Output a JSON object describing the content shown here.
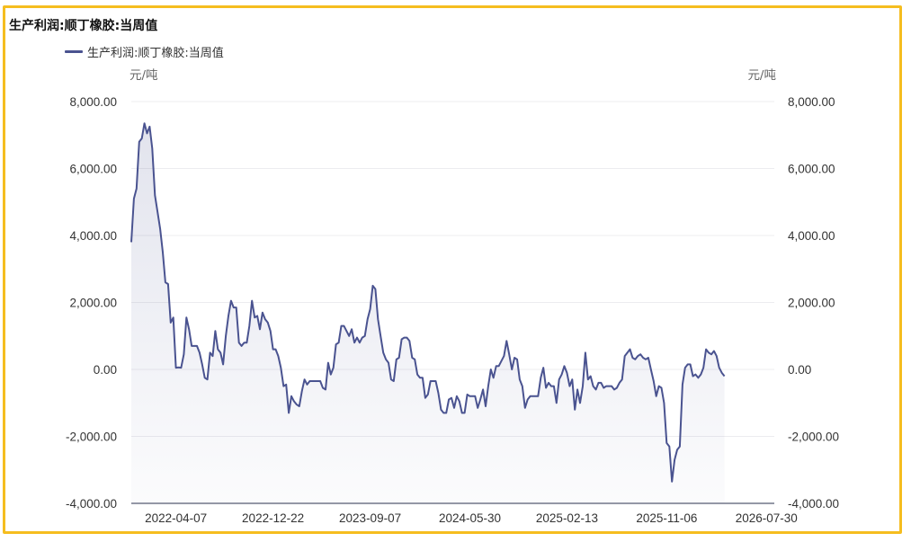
{
  "chart_data": {
    "type": "area",
    "title": "生产利润:顺丁橡胶:当周值",
    "legend": "生产利润:顺丁橡胶:当周值",
    "y_unit_left": "元/吨",
    "y_unit_right": "元/吨",
    "ylim": [
      -4000,
      8000
    ],
    "yticks": [
      "8,000.00",
      "6,000.00",
      "4,000.00",
      "2,000.00",
      "0.00",
      "-2,000.00",
      "-4,000.00"
    ],
    "xticks": [
      "2022-04-07",
      "2022-12-22",
      "2023-09-07",
      "2024-05-30",
      "2025-02-13",
      "2025-11-06",
      "2026-07-30"
    ],
    "xlim": [
      "2021-12-09",
      "2026-08-20"
    ],
    "grid": true,
    "line_color": "#4a5390",
    "series": [
      {
        "name": "生产利润:顺丁橡胶:当周值",
        "points": [
          [
            "2021-12-09",
            3800
          ],
          [
            "2021-12-16",
            5100
          ],
          [
            "2021-12-23",
            5400
          ],
          [
            "2021-12-30",
            6800
          ],
          [
            "2022-01-06",
            6900
          ],
          [
            "2022-01-13",
            7350
          ],
          [
            "2022-01-20",
            7050
          ],
          [
            "2022-01-27",
            7250
          ],
          [
            "2022-02-03",
            6600
          ],
          [
            "2022-02-10",
            5200
          ],
          [
            "2022-02-17",
            4700
          ],
          [
            "2022-02-24",
            4200
          ],
          [
            "2022-03-03",
            3500
          ],
          [
            "2022-03-10",
            2600
          ],
          [
            "2022-03-17",
            2550
          ],
          [
            "2022-03-24",
            1400
          ],
          [
            "2022-03-31",
            1550
          ],
          [
            "2022-04-07",
            50
          ],
          [
            "2022-04-14",
            60
          ],
          [
            "2022-04-21",
            50
          ],
          [
            "2022-04-28",
            450
          ],
          [
            "2022-05-05",
            1550
          ],
          [
            "2022-05-12",
            1200
          ],
          [
            "2022-05-19",
            700
          ],
          [
            "2022-05-26",
            700
          ],
          [
            "2022-06-02",
            700
          ],
          [
            "2022-06-09",
            500
          ],
          [
            "2022-06-16",
            150
          ],
          [
            "2022-06-23",
            -250
          ],
          [
            "2022-06-30",
            -300
          ],
          [
            "2022-07-07",
            500
          ],
          [
            "2022-07-14",
            400
          ],
          [
            "2022-07-21",
            1150
          ],
          [
            "2022-07-28",
            600
          ],
          [
            "2022-08-04",
            500
          ],
          [
            "2022-08-11",
            150
          ],
          [
            "2022-08-18",
            1000
          ],
          [
            "2022-08-25",
            1600
          ],
          [
            "2022-09-01",
            2050
          ],
          [
            "2022-09-08",
            1850
          ],
          [
            "2022-09-15",
            1850
          ],
          [
            "2022-09-22",
            800
          ],
          [
            "2022-09-29",
            700
          ],
          [
            "2022-10-06",
            800
          ],
          [
            "2022-10-13",
            800
          ],
          [
            "2022-10-20",
            1300
          ],
          [
            "2022-10-27",
            2050
          ],
          [
            "2022-11-03",
            1550
          ],
          [
            "2022-11-10",
            1600
          ],
          [
            "2022-11-17",
            1200
          ],
          [
            "2022-11-24",
            1700
          ],
          [
            "2022-12-01",
            1500
          ],
          [
            "2022-12-08",
            1400
          ],
          [
            "2022-12-15",
            1150
          ],
          [
            "2022-12-22",
            600
          ],
          [
            "2022-12-29",
            600
          ],
          [
            "2023-01-05",
            400
          ],
          [
            "2023-01-12",
            50
          ],
          [
            "2023-01-19",
            -500
          ],
          [
            "2023-01-26",
            -450
          ],
          [
            "2023-02-02",
            -1300
          ],
          [
            "2023-02-09",
            -800
          ],
          [
            "2023-02-16",
            -950
          ],
          [
            "2023-02-23",
            -1050
          ],
          [
            "2023-03-02",
            -1100
          ],
          [
            "2023-03-09",
            -650
          ],
          [
            "2023-03-16",
            -300
          ],
          [
            "2023-03-23",
            -450
          ],
          [
            "2023-03-30",
            -350
          ],
          [
            "2023-04-06",
            -350
          ],
          [
            "2023-04-13",
            -350
          ],
          [
            "2023-04-20",
            -350
          ],
          [
            "2023-04-27",
            -350
          ],
          [
            "2023-05-04",
            -550
          ],
          [
            "2023-05-11",
            -600
          ],
          [
            "2023-05-18",
            200
          ],
          [
            "2023-05-25",
            -150
          ],
          [
            "2023-06-01",
            50
          ],
          [
            "2023-06-08",
            750
          ],
          [
            "2023-06-15",
            800
          ],
          [
            "2023-06-22",
            1300
          ],
          [
            "2023-06-29",
            1300
          ],
          [
            "2023-07-06",
            1150
          ],
          [
            "2023-07-13",
            1000
          ],
          [
            "2023-07-20",
            1200
          ],
          [
            "2023-07-27",
            800
          ],
          [
            "2023-08-03",
            950
          ],
          [
            "2023-08-10",
            800
          ],
          [
            "2023-08-17",
            950
          ],
          [
            "2023-08-24",
            1000
          ],
          [
            "2023-08-31",
            1500
          ],
          [
            "2023-09-07",
            1800
          ],
          [
            "2023-09-14",
            2500
          ],
          [
            "2023-09-21",
            2400
          ],
          [
            "2023-09-28",
            1500
          ],
          [
            "2023-10-05",
            1000
          ],
          [
            "2023-10-12",
            500
          ],
          [
            "2023-10-19",
            300
          ],
          [
            "2023-10-26",
            200
          ],
          [
            "2023-11-02",
            -300
          ],
          [
            "2023-11-09",
            -350
          ],
          [
            "2023-11-16",
            300
          ],
          [
            "2023-11-23",
            350
          ],
          [
            "2023-11-30",
            900
          ],
          [
            "2023-12-07",
            950
          ],
          [
            "2023-12-14",
            950
          ],
          [
            "2023-12-21",
            850
          ],
          [
            "2023-12-28",
            350
          ],
          [
            "2024-01-04",
            300
          ],
          [
            "2024-01-11",
            -150
          ],
          [
            "2024-01-18",
            -250
          ],
          [
            "2024-01-25",
            -250
          ],
          [
            "2024-02-01",
            -850
          ],
          [
            "2024-02-08",
            -750
          ],
          [
            "2024-02-15",
            -350
          ],
          [
            "2024-02-22",
            -350
          ],
          [
            "2024-02-29",
            -350
          ],
          [
            "2024-03-07",
            -700
          ],
          [
            "2024-03-14",
            -1200
          ],
          [
            "2024-03-21",
            -1300
          ],
          [
            "2024-03-28",
            -1300
          ],
          [
            "2024-04-04",
            -900
          ],
          [
            "2024-04-11",
            -850
          ],
          [
            "2024-04-18",
            -1150
          ],
          [
            "2024-04-25",
            -800
          ],
          [
            "2024-05-02",
            -950
          ],
          [
            "2024-05-09",
            -1300
          ],
          [
            "2024-05-16",
            -1300
          ],
          [
            "2024-05-23",
            -750
          ],
          [
            "2024-05-30",
            -800
          ],
          [
            "2024-06-06",
            -800
          ],
          [
            "2024-06-13",
            -800
          ],
          [
            "2024-06-20",
            -1150
          ],
          [
            "2024-06-27",
            -900
          ],
          [
            "2024-07-04",
            -600
          ],
          [
            "2024-07-11",
            -1100
          ],
          [
            "2024-07-18",
            -500
          ],
          [
            "2024-07-25",
            0
          ],
          [
            "2024-08-01",
            -250
          ],
          [
            "2024-08-08",
            100
          ],
          [
            "2024-08-15",
            100
          ],
          [
            "2024-08-22",
            250
          ],
          [
            "2024-08-29",
            400
          ],
          [
            "2024-09-05",
            850
          ],
          [
            "2024-09-12",
            450
          ],
          [
            "2024-09-19",
            0
          ],
          [
            "2024-09-26",
            350
          ],
          [
            "2024-10-03",
            300
          ],
          [
            "2024-10-10",
            -300
          ],
          [
            "2024-10-17",
            -500
          ],
          [
            "2024-10-24",
            -1150
          ],
          [
            "2024-10-31",
            -900
          ],
          [
            "2024-11-07",
            -800
          ],
          [
            "2024-11-14",
            -800
          ],
          [
            "2024-11-21",
            -800
          ],
          [
            "2024-11-28",
            -800
          ],
          [
            "2024-12-05",
            -250
          ],
          [
            "2024-12-12",
            50
          ],
          [
            "2024-12-19",
            -550
          ],
          [
            "2024-12-26",
            -400
          ],
          [
            "2025-01-02",
            -500
          ],
          [
            "2025-01-09",
            -500
          ],
          [
            "2025-01-16",
            -1000
          ],
          [
            "2025-01-23",
            -300
          ],
          [
            "2025-01-30",
            -150
          ],
          [
            "2025-02-06",
            100
          ],
          [
            "2025-02-13",
            -100
          ],
          [
            "2025-02-20",
            -500
          ],
          [
            "2025-02-27",
            -300
          ],
          [
            "2025-03-06",
            -1200
          ],
          [
            "2025-03-13",
            -600
          ],
          [
            "2025-03-20",
            -1000
          ],
          [
            "2025-03-27",
            -500
          ],
          [
            "2025-04-03",
            500
          ],
          [
            "2025-04-10",
            -300
          ],
          [
            "2025-04-17",
            -200
          ],
          [
            "2025-04-24",
            -500
          ],
          [
            "2025-05-01",
            -600
          ],
          [
            "2025-05-08",
            -400
          ],
          [
            "2025-05-15",
            -400
          ],
          [
            "2025-05-22",
            -550
          ],
          [
            "2025-05-29",
            -500
          ],
          [
            "2025-06-05",
            -500
          ],
          [
            "2025-06-12",
            -500
          ],
          [
            "2025-06-19",
            -600
          ],
          [
            "2025-06-26",
            -550
          ],
          [
            "2025-07-03",
            -400
          ],
          [
            "2025-07-10",
            -300
          ],
          [
            "2025-07-17",
            400
          ],
          [
            "2025-07-24",
            500
          ],
          [
            "2025-07-31",
            600
          ],
          [
            "2025-08-07",
            350
          ],
          [
            "2025-08-14",
            300
          ],
          [
            "2025-08-21",
            400
          ],
          [
            "2025-08-28",
            450
          ],
          [
            "2025-09-04",
            350
          ],
          [
            "2025-09-11",
            300
          ],
          [
            "2025-09-18",
            350
          ],
          [
            "2025-09-25",
            0
          ],
          [
            "2025-10-02",
            -350
          ],
          [
            "2025-10-09",
            -800
          ],
          [
            "2025-10-16",
            -500
          ],
          [
            "2025-10-23",
            -550
          ],
          [
            "2025-10-30",
            -1000
          ],
          [
            "2025-11-06",
            -2200
          ],
          [
            "2025-11-13",
            -2300
          ],
          [
            "2025-11-20",
            -3350
          ],
          [
            "2025-11-27",
            -2700
          ],
          [
            "2025-12-04",
            -2400
          ],
          [
            "2025-12-11",
            -2300
          ],
          [
            "2025-12-18",
            -450
          ],
          [
            "2025-12-25",
            50
          ],
          [
            "2026-01-01",
            150
          ],
          [
            "2026-01-08",
            150
          ],
          [
            "2026-01-15",
            -200
          ],
          [
            "2026-01-22",
            -150
          ],
          [
            "2026-01-29",
            -250
          ],
          [
            "2026-02-05",
            -150
          ],
          [
            "2026-02-12",
            50
          ],
          [
            "2026-02-19",
            600
          ],
          [
            "2026-02-26",
            500
          ],
          [
            "2026-03-05",
            450
          ],
          [
            "2026-03-12",
            550
          ],
          [
            "2026-03-19",
            400
          ],
          [
            "2026-03-26",
            50
          ],
          [
            "2026-04-02",
            -100
          ],
          [
            "2026-04-09",
            -200
          ]
        ]
      }
    ]
  }
}
